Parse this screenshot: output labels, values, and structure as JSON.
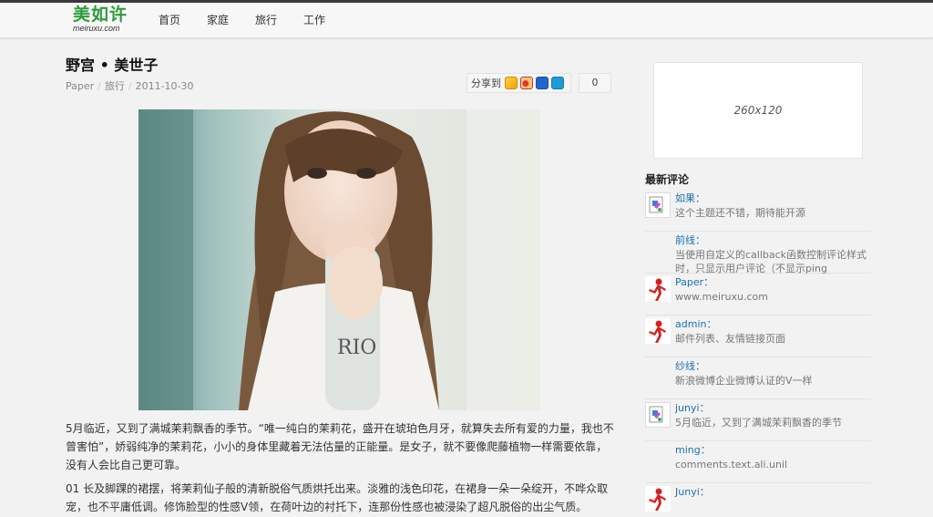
{
  "header": {
    "logo_cn": "美如许",
    "logo_en": "meiruxu.com",
    "nav": [
      "首页",
      "家庭",
      "旅行",
      "工作"
    ]
  },
  "post": {
    "title": "野宫 • 美世子",
    "meta": {
      "author": "Paper",
      "category": "旅行",
      "date": "2011-10-30"
    },
    "share_label": "分享到",
    "share_count": "0",
    "paragraphs": [
      "5月临近，又到了满城茉莉飘香的季节。“唯一纯白的茉莉花，盛开在琥珀色月牙，就算失去所有爱的力量，我也不曾害怕”，娇弱纯净的茉莉花，小小的身体里藏着无法估量的正能量。是女子，就不要像爬藤植物一样需要依靠，没有人会比自己更可靠。",
      "01 长及脚踝的裙摆，将茉莉仙子般的清新脱俗气质烘托出来。淡雅的浅色印花，在裙身一朵一朵绽开，不哗众取宠，也不平庸低调。修饰脸型的性感V领，在荷叶边的衬托下，连那份性感也被浸染了超凡脱俗的出尘气质。"
    ]
  },
  "sidebar": {
    "ad_text": "260x120",
    "comments_title": "最新评论",
    "comments": [
      {
        "author": "如果：",
        "text": "这个主题还不错，期待能开源",
        "avatar": "image-placeholder-icon"
      },
      {
        "author": "前线：",
        "text": "当使用自定义的callback函数控制评论样式时，只显示用户评论（不显示ping",
        "avatar": "none"
      },
      {
        "author": "Paper：",
        "text": "www.meiruxu.com",
        "avatar": "red-figure-icon"
      },
      {
        "author": "admin：",
        "text": "邮件列表、友情链接页面",
        "avatar": "red-figure-icon"
      },
      {
        "author": "纱线：",
        "text": "新浪微博企业微博认证的V一样",
        "avatar": "none"
      },
      {
        "author": "junyi：",
        "text": "5月临近，又到了满城茉莉飘香的季节",
        "avatar": "image-placeholder-icon"
      },
      {
        "author": "ming：",
        "text": "comments.text.ali.unil",
        "avatar": "none"
      },
      {
        "author": "Junyi：",
        "text": "",
        "avatar": "red-figure-icon"
      }
    ]
  },
  "colors": {
    "logo": "#2e9b3a",
    "link": "#1a6fb0",
    "topbar_border": "#3a3a3a"
  }
}
